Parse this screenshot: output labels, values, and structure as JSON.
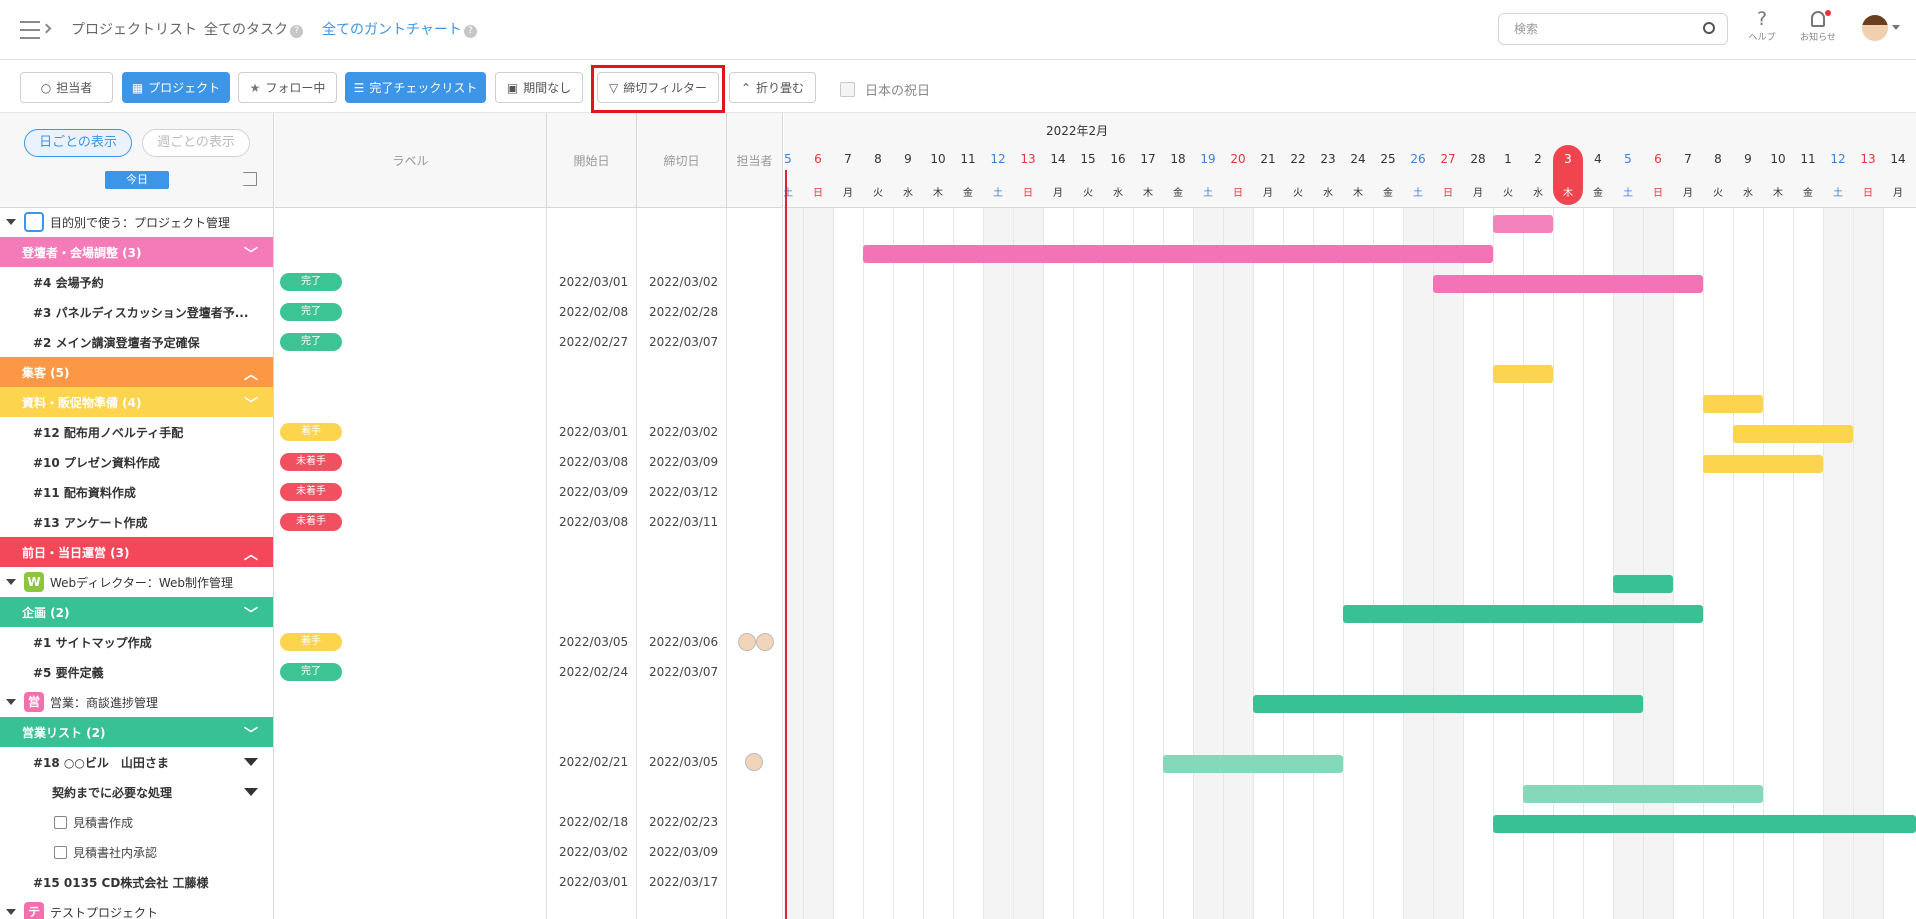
{
  "header": {
    "nav": [
      "プロジェクトリスト",
      "全てのタスク",
      "全てのガントチャート"
    ],
    "search_placeholder": "検索",
    "help": "ヘルプ",
    "notice": "お知らせ"
  },
  "toolbar": [
    "担当者",
    "プロジェクト",
    "フォロー中",
    "完了チェックリスト",
    "期間なし",
    "締切フィルター",
    "折り畳む",
    "日本の祝日"
  ],
  "left": {
    "daily": "日ごとの表示",
    "weekly": "週ごとの表示",
    "today": "今日"
  },
  "columns": {
    "label": "ラベル",
    "start": "開始日",
    "end": "締切日",
    "assignee": "担当者"
  },
  "chart": {
    "month": "2022年2月",
    "days": [
      "5",
      "6",
      "7",
      "8",
      "9",
      "10",
      "11",
      "12",
      "13",
      "14",
      "15",
      "16",
      "17",
      "18",
      "19",
      "20",
      "21",
      "22",
      "23",
      "24",
      "25",
      "26",
      "27",
      "28",
      "1",
      "2",
      "3",
      "4",
      "5",
      "6",
      "7",
      "8",
      "9",
      "10",
      "11",
      "12",
      "13",
      "14"
    ],
    "weekdays": [
      "土",
      "日",
      "月",
      "火",
      "水",
      "木",
      "金",
      "土",
      "日",
      "月",
      "火",
      "水",
      "木",
      "金",
      "土",
      "日",
      "月",
      "火",
      "水",
      "木",
      "金",
      "土",
      "日",
      "月",
      "火",
      "水",
      "木",
      "金",
      "土",
      "日",
      "月",
      "火",
      "水",
      "木",
      "金",
      "土",
      "日",
      "月"
    ]
  },
  "rows": [
    {
      "name": "目的別で使う：プロジェクト管理",
      "kind": "proj"
    },
    {
      "name": "登壇者・会場調整 (3)",
      "kind": "grp",
      "color": "#f47ab8"
    },
    {
      "name": "#4 会場予約",
      "kind": "task",
      "label": "完了",
      "start": "2022/03/01",
      "end": "2022/03/02"
    },
    {
      "name": "#3 パネルディスカッション登壇者予...",
      "kind": "task",
      "label": "完了",
      "start": "2022/02/08",
      "end": "2022/02/28"
    },
    {
      "name": "#2 メイン講演登壇者予定確保",
      "kind": "task",
      "label": "完了",
      "start": "2022/02/27",
      "end": "2022/03/07"
    },
    {
      "name": "集客 (5)",
      "kind": "grp",
      "color": "#fc9745"
    },
    {
      "name": "資料・販促物準備 (4)",
      "kind": "grp",
      "color": "#fcd44e"
    },
    {
      "name": "#12 配布用ノベルティ手配",
      "kind": "task",
      "label": "着手",
      "start": "2022/03/01",
      "end": "2022/03/02"
    },
    {
      "name": "#10 プレゼン資料作成",
      "kind": "task",
      "label": "未着手",
      "start": "2022/03/08",
      "end": "2022/03/09"
    },
    {
      "name": "#11 配布資料作成",
      "kind": "task",
      "label": "未着手",
      "start": "2022/03/09",
      "end": "2022/03/12"
    },
    {
      "name": "#13 アンケート作成",
      "kind": "task",
      "label": "未着手",
      "start": "2022/03/08",
      "end": "2022/03/11"
    },
    {
      "name": "前日・当日運営 (3)",
      "kind": "grp",
      "color": "#f2485a"
    },
    {
      "name": "Webディレクター：Web制作管理",
      "kind": "proj"
    },
    {
      "name": "企画 (2)",
      "kind": "grp",
      "color": "#39c196"
    },
    {
      "name": "#1 サイトマップ作成",
      "kind": "task",
      "label": "着手",
      "start": "2022/03/05",
      "end": "2022/03/06"
    },
    {
      "name": "#5 要件定義",
      "kind": "task",
      "label": "完了",
      "start": "2022/02/24",
      "end": "2022/03/07"
    },
    {
      "name": "営業：商談進捗管理",
      "kind": "proj"
    },
    {
      "name": "営業リスト (2)",
      "kind": "grp",
      "color": "#39c196"
    },
    {
      "name": "#18 ○○ビル　山田さま",
      "kind": "task",
      "start": "2022/02/21",
      "end": "2022/03/05"
    },
    {
      "name": "契約までに必要な処理",
      "kind": "sub"
    },
    {
      "name": "見積書作成",
      "kind": "check",
      "start": "2022/02/18",
      "end": "2022/02/23"
    },
    {
      "name": "見積書社内承認",
      "kind": "check",
      "start": "2022/03/02",
      "end": "2022/03/09"
    },
    {
      "name": "#15 0135 CD株式会社 工藤様",
      "kind": "task",
      "start": "2022/03/01",
      "end": "2022/03/17"
    },
    {
      "name": "テストプロジェクト",
      "kind": "proj"
    }
  ],
  "project_badges": [
    "",
    "W",
    "営",
    "テ"
  ]
}
